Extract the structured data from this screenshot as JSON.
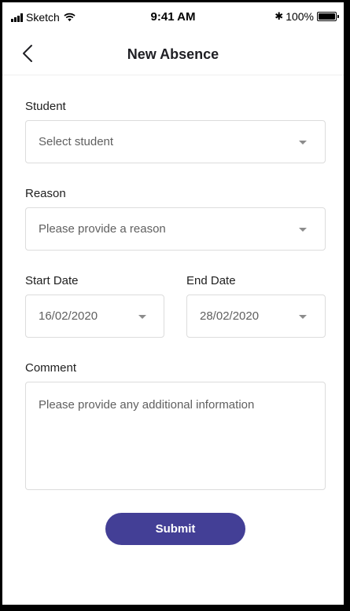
{
  "status_bar": {
    "carrier": "Sketch",
    "time": "9:41 AM",
    "battery": "100%",
    "battery_level": 1.0
  },
  "header": {
    "title": "New Absence",
    "back_icon": "chevron-left-icon"
  },
  "form": {
    "student": {
      "label": "Student",
      "placeholder": "Select student"
    },
    "reason": {
      "label": "Reason",
      "placeholder": "Please provide a reason"
    },
    "start_date": {
      "label": "Start Date",
      "value": "16/02/2020"
    },
    "end_date": {
      "label": "End Date",
      "value": "28/02/2020"
    },
    "comment": {
      "label": "Comment",
      "placeholder": "Please provide any additional information"
    },
    "submit_label": "Submit"
  },
  "colors": {
    "accent": "#433f96",
    "border": "#dcdcdc",
    "placeholder_text": "#606060"
  }
}
